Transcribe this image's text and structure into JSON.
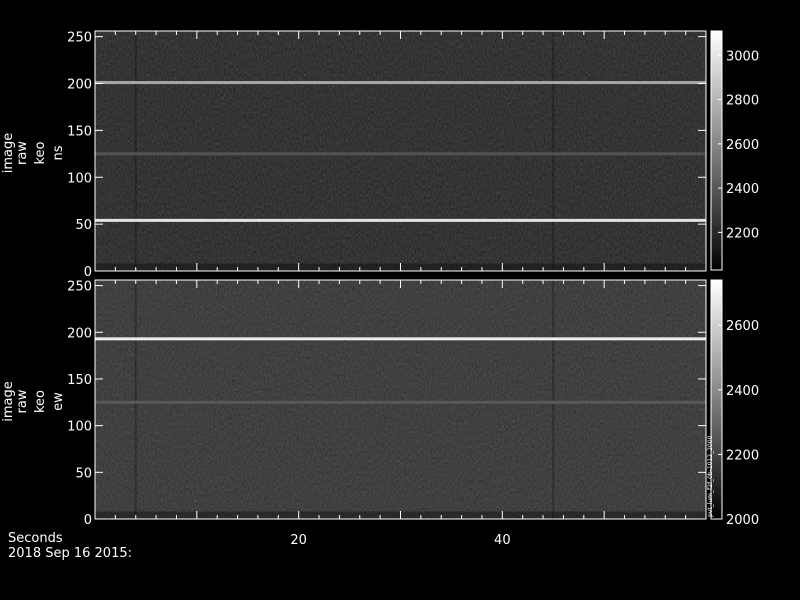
{
  "chart_data": [
    {
      "type": "heatmap",
      "ylabel": [
        "image",
        "raw",
        "keo",
        "ns"
      ],
      "x_range": [
        0,
        60
      ],
      "ylim": [
        0,
        256
      ],
      "y_ticks": [
        0,
        50,
        100,
        150,
        200,
        250
      ],
      "background": "#1c1c1c",
      "bright_rows": [
        {
          "y": 54,
          "intensity": 0.85
        },
        {
          "y": 201,
          "intensity": 0.55
        },
        {
          "y": 125,
          "intensity": 0.12
        }
      ],
      "colorbar": {
        "range": [
          2030,
          3110
        ],
        "ticks": [
          2200,
          2400,
          2600,
          2800,
          3000
        ]
      }
    },
    {
      "type": "heatmap",
      "ylabel": [
        "image",
        "raw",
        "keo",
        "ew"
      ],
      "x_range": [
        0,
        60
      ],
      "ylim": [
        0,
        256
      ],
      "y_ticks": [
        0,
        50,
        100,
        150,
        200,
        250
      ],
      "background": "#2a2a2a",
      "bright_rows": [
        {
          "y": 193,
          "intensity": 0.9
        },
        {
          "y": 125,
          "intensity": 0.15
        }
      ],
      "colorbar": {
        "range": [
          2000,
          2740
        ],
        "ticks": [
          2000,
          2200,
          2400,
          2600
        ]
      },
      "side_note": "pvt_lum_f2f_0b-1012_2000"
    }
  ],
  "x_axis": {
    "label": "Seconds",
    "ticks": [
      20,
      40
    ]
  },
  "footer": {
    "date": "2018 Sep 16 2015:"
  }
}
